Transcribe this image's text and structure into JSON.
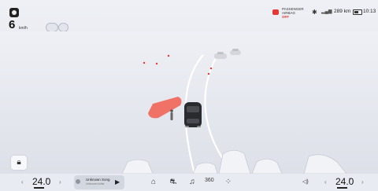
{
  "speed": {
    "value": "6",
    "unit": "km/h"
  },
  "status": {
    "airbag_label": "PASSENGER AIRBAG",
    "airbag_state": "OFF",
    "range": "289 km",
    "clock": "10:13"
  },
  "media": {
    "title": "Unknown Song",
    "artist": "Unknown Artist",
    "play_glyph": "▶"
  },
  "climate": {
    "left_temp": "24.0",
    "right_temp": "24.0",
    "unit": "°"
  },
  "dock": {
    "label_360": "360"
  },
  "icons": {
    "chev_left": "‹",
    "chev_right": "›",
    "bluetooth": "✱",
    "signal": "▂▄▆",
    "lock": "🔒︎",
    "home": "⌂",
    "car": "⛐",
    "music": "♫",
    "grid": "⁘",
    "volume": "◁)"
  },
  "colors": {
    "alert": "#e53935",
    "pedestrian_zone": "#f06a5e",
    "ego_vehicle": "#222222"
  }
}
